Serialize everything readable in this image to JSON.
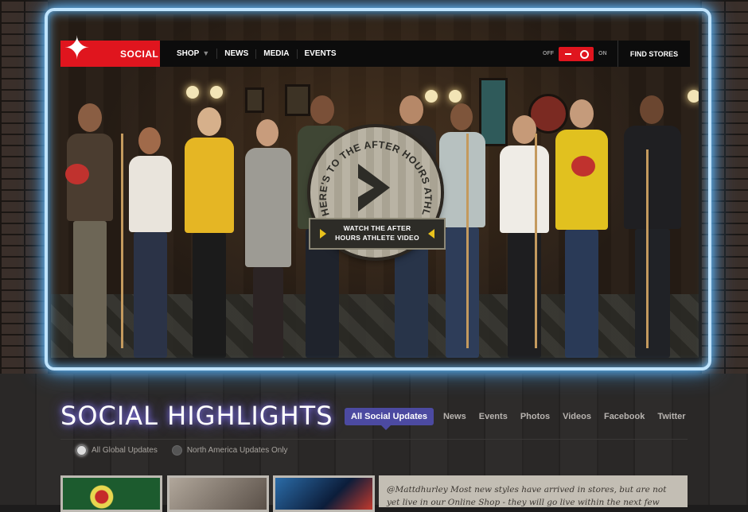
{
  "nav": {
    "logo_label": "SOCIAL",
    "links": [
      {
        "label": "SHOP"
      },
      {
        "label": "NEWS"
      },
      {
        "label": "MEDIA"
      },
      {
        "label": "EVENTS"
      }
    ],
    "toggle_off": "OFF",
    "toggle_on": "ON",
    "find_stores": "FIND STORES"
  },
  "hero": {
    "badge_arc_text": "HERE'S TO THE AFTER HOURS ATHLETE",
    "cta_line1": "WATCH THE AFTER",
    "cta_line2": "HOURS ATHLETE VIDEO"
  },
  "highlights": {
    "title": "SOCIAL HIGHLIGHTS",
    "tabs": [
      {
        "label": "All Social Updates"
      },
      {
        "label": "News"
      },
      {
        "label": "Events"
      },
      {
        "label": "Photos"
      },
      {
        "label": "Videos"
      },
      {
        "label": "Facebook"
      },
      {
        "label": "Twitter"
      }
    ],
    "filters": [
      {
        "label": "All Global Updates"
      },
      {
        "label": "North America Updates Only"
      }
    ],
    "tweet": "@Mattdhurley Most new styles have arrived in stores, but are not yet live in our Online Shop - they will go live within the next few weeks!"
  },
  "colors": {
    "brand_red": "#e0151e",
    "tab_active": "#4c4aa1",
    "neon": "#bfe4ff"
  }
}
